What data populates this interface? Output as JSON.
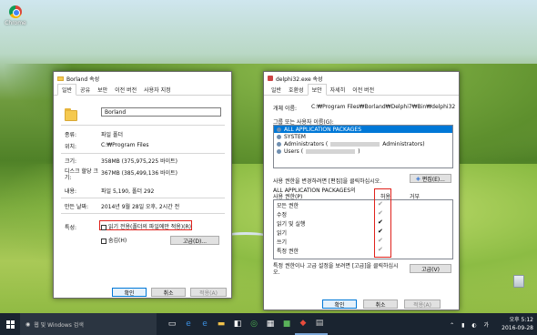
{
  "desktop": {
    "chrome_label": "Chrome"
  },
  "win1": {
    "title": "Borland 속성",
    "tabs": [
      "일반",
      "공유",
      "보안",
      "이전 버전",
      "사용자 지정"
    ],
    "name_value": "Borland",
    "rows": [
      {
        "label": "종류:",
        "value": "파일 폴더"
      },
      {
        "label": "위치:",
        "value": "C:₩Program Files"
      },
      {
        "label": "크기:",
        "value": "358MB (375,975,225 바이트)"
      },
      {
        "label": "디스크 할당 크기:",
        "value": "367MB (385,499,136 바이트)"
      },
      {
        "label": "내용:",
        "value": "파일 5,190, 폴더 292"
      },
      {
        "label": "만든 날짜:",
        "value": "2014년 9월 28일 오후, 2시간 전"
      }
    ],
    "attr_label": "특성:",
    "readonly_label": "읽기 전용(폴더의 파일에만 적용)(R)",
    "hidden_label": "숨김(H)",
    "advanced_btn": "고급(D)...",
    "ok": "확인",
    "cancel": "취소",
    "apply": "적용(A)"
  },
  "win2": {
    "title": "delphi32.exe 속성",
    "tabs": [
      "일반",
      "호환성",
      "보안",
      "자세히",
      "이전 버전"
    ],
    "object_label": "개체 이름:",
    "object_value": "C:₩Program Files₩Borland₩Delphi7₩Bin₩delphi32",
    "group_label": "그룹 또는 사용자 이름(G):",
    "users": [
      {
        "name": "ALL APPLICATION PACKAGES",
        "selected": true
      },
      {
        "name": "SYSTEM",
        "selected": false
      },
      {
        "name": "Administrators (",
        "suffix": "Administrators)",
        "selected": false
      },
      {
        "name": "Users (",
        "suffix": ")",
        "selected": false
      }
    ],
    "change_text": "사용 권한을 변경하려면 [편집]을 클릭하십시오.",
    "edit_btn": "편집(E)...",
    "perm_title": "ALL APPLICATION PACKAGES의",
    "perm_sub": "사용 권한(P)",
    "allow": "허용",
    "deny": "거부",
    "perms": [
      {
        "name": "모든 권한",
        "allow": false
      },
      {
        "name": "수정",
        "allow": false
      },
      {
        "name": "읽기 및 실행",
        "allow": true
      },
      {
        "name": "읽기",
        "allow": true
      },
      {
        "name": "쓰기",
        "allow": false
      },
      {
        "name": "특정 권한",
        "allow": false
      }
    ],
    "adv_text": "특정 권한이나 고급 설정을 보려면 [고급]을 클릭하십시오.",
    "adv_btn": "고급(V)",
    "ok": "확인",
    "cancel": "취소",
    "apply": "적용(A)"
  },
  "taskbar": {
    "search_placeholder": "웹 및 Windows 검색",
    "time": "오후 5:12",
    "date": "2016-09-28",
    "ime": "가"
  }
}
